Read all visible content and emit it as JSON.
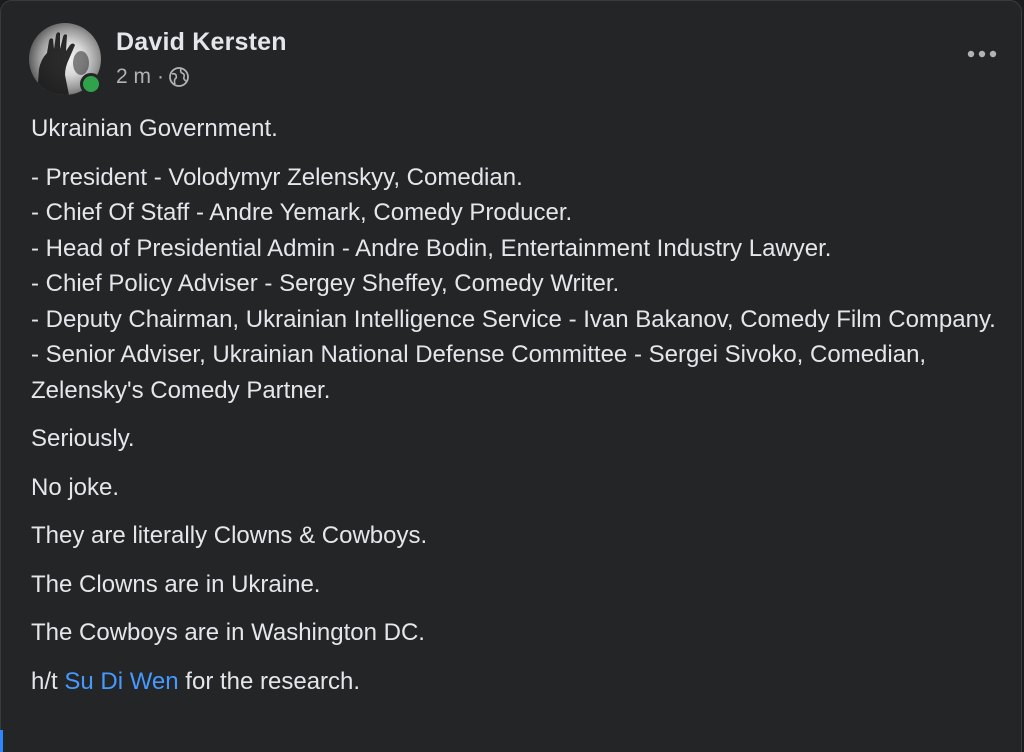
{
  "post": {
    "author": "David Kersten",
    "time": "2 m",
    "separator": "·",
    "audience_icon": "globe-icon",
    "more_icon": "more-horizontal-icon",
    "heading": "Ukrainian Government.",
    "roles": [
      "- President - Volodymyr Zelenskyy, Comedian.",
      "- Chief Of Staff - Andre Yemark, Comedy Producer.",
      "- Head of Presidential Admin - Andre Bodin, Entertainment Industry Lawyer.",
      "- Chief Policy Adviser - Sergey Sheffey, Comedy Writer.",
      "- Deputy Chairman, Ukrainian Intelligence Service - Ivan Bakanov, Comedy Film Company.",
      "- Senior Adviser, Ukrainian National Defense Committee - Sergei Sivoko, Comedian, Zelensky's Comedy Partner."
    ],
    "paragraphs": [
      "Seriously.",
      "No joke.",
      "They are literally Clowns & Cowboys.",
      "The Clowns are in Ukraine.",
      "The Cowboys are in Washington DC."
    ],
    "credit_prefix": "h/t ",
    "credit_mention": "Su Di Wen",
    "credit_suffix": " for the research."
  },
  "colors": {
    "background": "#242526",
    "text": "#e4e6eb",
    "secondary_text": "#b0b3b8",
    "link": "#4599ff",
    "online": "#31a24c"
  }
}
